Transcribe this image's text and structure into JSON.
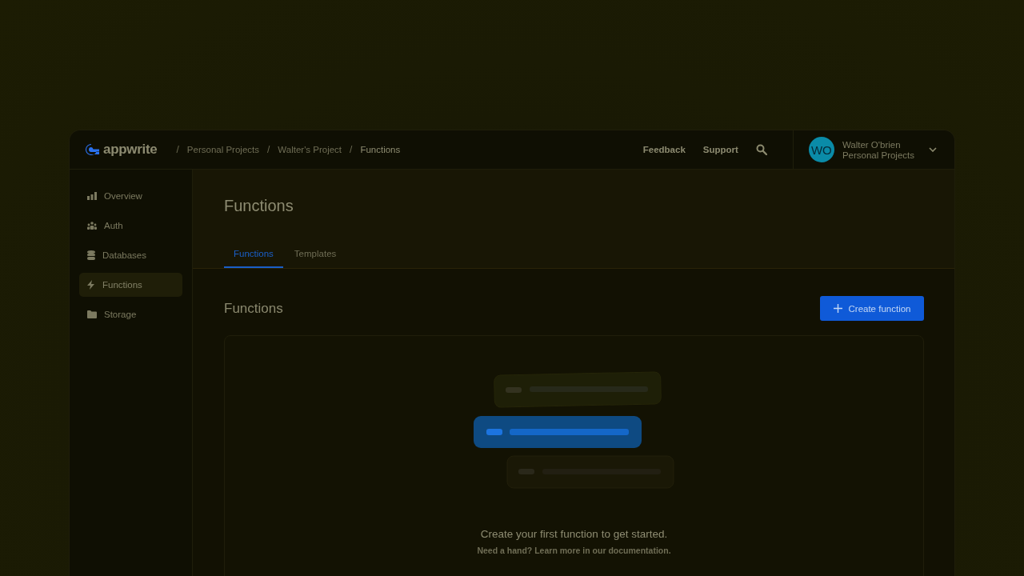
{
  "header": {
    "logo": "appwrite",
    "breadcrumbs": [
      {
        "label": "Personal Projects",
        "current": false
      },
      {
        "label": "Walter's Project",
        "current": false
      },
      {
        "label": "Functions",
        "current": true
      }
    ],
    "separator": "/",
    "links": [
      "Feedback",
      "Support"
    ],
    "user": {
      "initials": "WO",
      "name": "Walter O'brien",
      "org": "Personal Projects"
    }
  },
  "sidebar": {
    "items": [
      {
        "label": "Overview",
        "selected": false
      },
      {
        "label": "Auth",
        "selected": false
      },
      {
        "label": "Databases",
        "selected": false
      },
      {
        "label": "Functions",
        "selected": true
      },
      {
        "label": "Storage",
        "selected": false
      }
    ]
  },
  "page_title": "Functions",
  "tabs": [
    {
      "label": "Functions",
      "selected": true
    },
    {
      "label": "Templates",
      "selected": false
    }
  ],
  "section": {
    "title": "Functions",
    "button": "Create function"
  },
  "empty_state": {
    "title": "Create your first function to get started.",
    "hint": "Need a hand? Learn more in our documentation."
  }
}
